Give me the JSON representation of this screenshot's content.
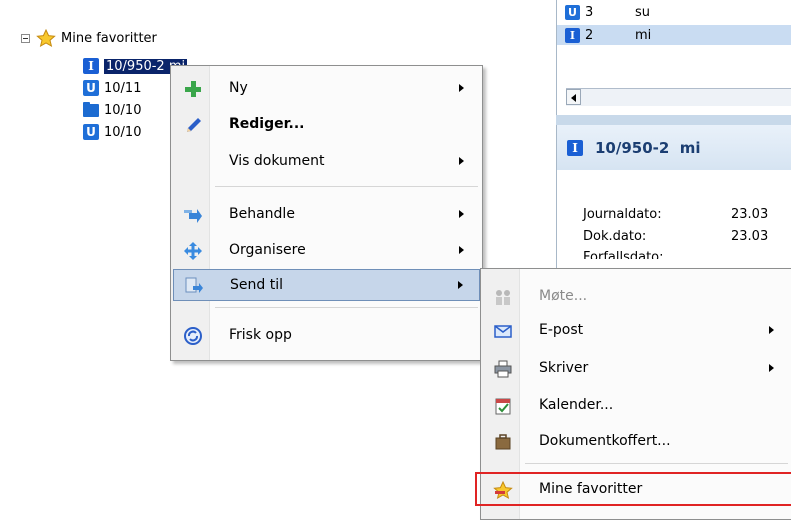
{
  "tree": {
    "root_label": "Mine favoritter",
    "items": [
      {
        "badge": "I",
        "label": "10/950-2 mi"
      },
      {
        "badge": "U",
        "label": "10/11"
      },
      {
        "badge": "folder",
        "label": "10/10"
      },
      {
        "badge": "U",
        "label": "10/10"
      }
    ]
  },
  "list": {
    "rows": [
      {
        "badge": "U",
        "number": "3",
        "initials": "su"
      },
      {
        "badge": "I",
        "number": "2",
        "initials": "mi"
      }
    ]
  },
  "detail": {
    "badge": "I",
    "title": "10/950-2  mi",
    "fields": [
      {
        "label": "Journaldato:",
        "value": "23.03"
      },
      {
        "label": "Dok.dato:",
        "value": "23.03"
      },
      {
        "label": "Forfallsdato:",
        "value": ""
      }
    ]
  },
  "context_menu": {
    "items": [
      {
        "label": "Ny",
        "icon": "plus-icon",
        "submenu": true
      },
      {
        "label": "Rediger...",
        "icon": "pencil-icon",
        "submenu": false
      },
      {
        "label": "Vis dokument",
        "icon": "",
        "submenu": true
      },
      {
        "label": "Behandle",
        "icon": "process-arrow-icon",
        "submenu": true
      },
      {
        "label": "Organisere",
        "icon": "move-arrows-icon",
        "submenu": true
      },
      {
        "label": "Send til",
        "icon": "send-to-icon",
        "submenu": true
      },
      {
        "label": "Frisk opp",
        "icon": "refresh-icon",
        "submenu": false
      }
    ]
  },
  "send_submenu": {
    "items": [
      {
        "label": "Møte...",
        "icon": "meeting-icon",
        "submenu": false,
        "disabled": true
      },
      {
        "label": "E-post",
        "icon": "email-icon",
        "submenu": true
      },
      {
        "label": "Skriver",
        "icon": "printer-icon",
        "submenu": true
      },
      {
        "label": "Kalender...",
        "icon": "calendar-icon",
        "submenu": false
      },
      {
        "label": "Dokumentkoffert...",
        "icon": "briefcase-icon",
        "submenu": false
      },
      {
        "label": "Mine favoritter",
        "icon": "favorites-star-icon",
        "submenu": false
      }
    ]
  },
  "colors": {
    "selection": "#0a246a",
    "menu_highlight": "#c6d6ea",
    "badge_blue": "#1a5fd4",
    "callout_red": "#e02424"
  }
}
